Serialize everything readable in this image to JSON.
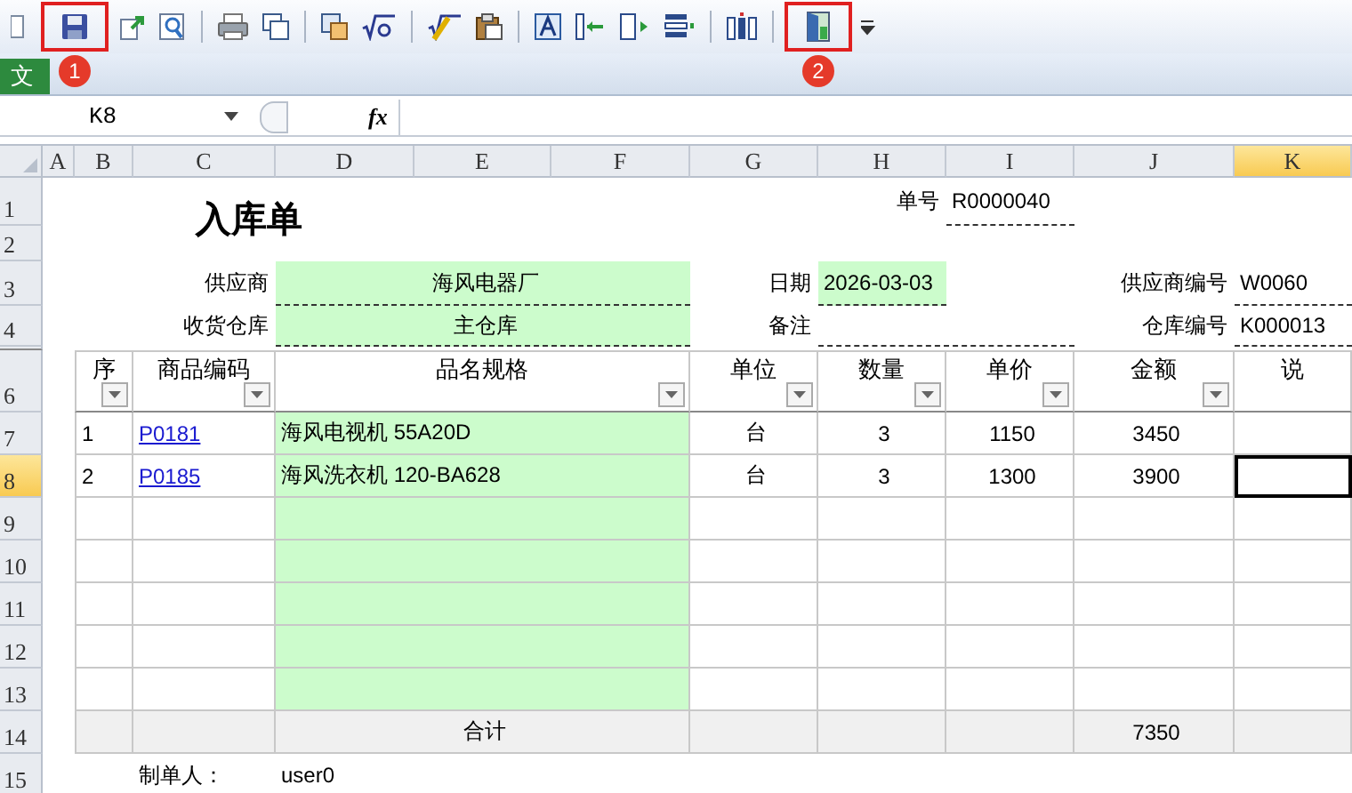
{
  "toolbar": {
    "buttons": [
      {
        "highlighted": false
      },
      {
        "highlighted": true,
        "badge": "1"
      },
      {
        "highlighted": false
      },
      {
        "highlighted": false
      },
      {
        "highlighted": false
      },
      {
        "highlighted": false
      },
      {
        "highlighted": false
      },
      {
        "highlighted": false
      },
      {
        "highlighted": false
      },
      {
        "highlighted": false
      },
      {
        "highlighted": false
      },
      {
        "highlighted": false
      },
      {
        "highlighted": false
      },
      {
        "highlighted": false
      },
      {
        "highlighted": false
      },
      {
        "highlighted": true,
        "badge": "2"
      }
    ]
  },
  "ribbon_tab": {
    "label": "文"
  },
  "name_box": {
    "value": "K8"
  },
  "formula_bar": {
    "fx": "fx"
  },
  "column_headers": [
    {
      "label": "A",
      "selected": false
    },
    {
      "label": "B",
      "selected": false
    },
    {
      "label": "C",
      "selected": false
    },
    {
      "label": "D",
      "selected": false
    },
    {
      "label": "E",
      "selected": false
    },
    {
      "label": "F",
      "selected": false
    },
    {
      "label": "G",
      "selected": false
    },
    {
      "label": "H",
      "selected": false
    },
    {
      "label": "I",
      "selected": false
    },
    {
      "label": "J",
      "selected": false
    },
    {
      "label": "K",
      "selected": true
    }
  ],
  "row_headers": [
    {
      "label": "1",
      "selected": false
    },
    {
      "label": "2",
      "selected": false
    },
    {
      "label": "3",
      "selected": false
    },
    {
      "label": "4",
      "selected": false
    },
    {
      "label": "6",
      "selected": false
    },
    {
      "label": "7",
      "selected": false
    },
    {
      "label": "8",
      "selected": true
    },
    {
      "label": "9",
      "selected": false
    },
    {
      "label": "10",
      "selected": false
    },
    {
      "label": "11",
      "selected": false
    },
    {
      "label": "12",
      "selected": false
    },
    {
      "label": "13",
      "selected": false
    },
    {
      "label": "14",
      "selected": false
    },
    {
      "label": "15",
      "selected": false
    }
  ],
  "form": {
    "title": "入库单",
    "order_no": {
      "label": "单号",
      "value": "R0000040"
    },
    "supplier": {
      "label": "供应商",
      "value": "海风电器厂"
    },
    "date": {
      "label": "日期",
      "value": "2026-03-03"
    },
    "supplier_code": {
      "label": "供应商编号",
      "value": "W0060"
    },
    "warehouse": {
      "label": "收货仓库",
      "value": "主仓库"
    },
    "remark": {
      "label": "备注"
    },
    "warehouse_code": {
      "label": "仓库编号",
      "value": "K000013"
    }
  },
  "table": {
    "columns": [
      {
        "label": "序",
        "filter": true
      },
      {
        "label": "商品编码",
        "filter": true
      },
      {
        "label": "品名规格",
        "filter": true
      },
      {
        "label": "单位",
        "filter": true
      },
      {
        "label": "数量",
        "filter": true
      },
      {
        "label": "单价",
        "filter": true
      },
      {
        "label": "金额",
        "filter": true
      },
      {
        "label": "说",
        "filter": false
      }
    ],
    "rows": [
      {
        "seq": "1",
        "code": "P0181",
        "name": "海风电视机 55A20D",
        "unit": "台",
        "qty": "3",
        "price": "1150",
        "amount": "3450"
      },
      {
        "seq": "2",
        "code": "P0185",
        "name": "海风洗衣机 120-BA628",
        "unit": "台",
        "qty": "3",
        "price": "1300",
        "amount": "3900"
      }
    ],
    "total": {
      "label": "合计",
      "amount": "7350"
    }
  },
  "footer": {
    "label": "制单人：",
    "value": "user0"
  }
}
